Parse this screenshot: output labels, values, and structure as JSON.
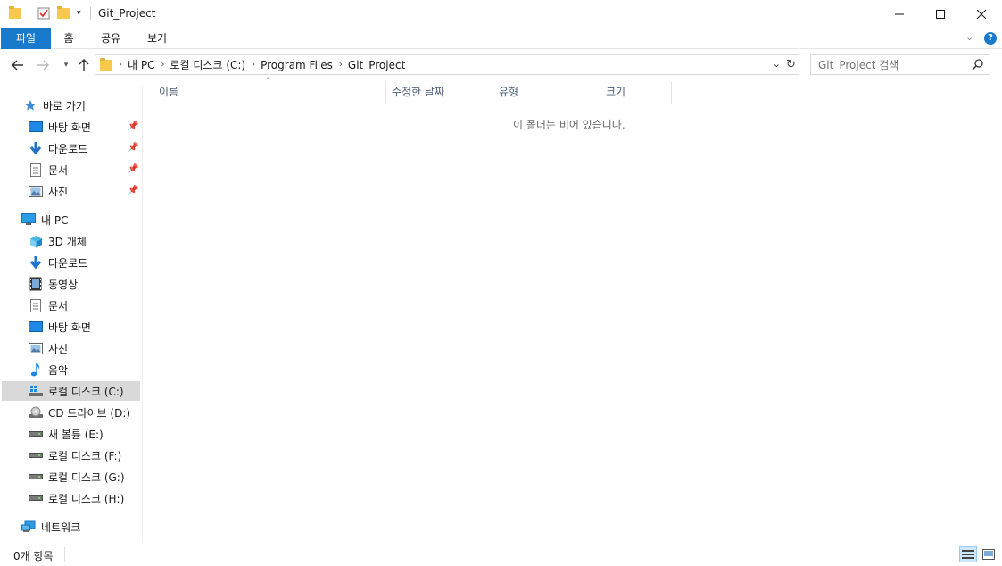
{
  "window": {
    "title": "Git_Project",
    "minimize": "—",
    "maximize": "☐",
    "close": "✕"
  },
  "ribbon": {
    "tabs": [
      "파일",
      "홈",
      "공유",
      "보기"
    ],
    "help": "?"
  },
  "address": {
    "crumbs": [
      "내 PC",
      "로컬 디스크 (C:)",
      "Program Files",
      "Git_Project"
    ]
  },
  "search": {
    "placeholder": "Git_Project 검색"
  },
  "columns": [
    "이름",
    "수정한 날짜",
    "유형",
    "크기"
  ],
  "content": {
    "empty_message": "이 폴더는 비어 있습니다."
  },
  "sidebar": {
    "quick_access": "바로 가기",
    "quick_items": [
      {
        "label": "바탕 화면",
        "icon": "desktop-icon"
      },
      {
        "label": "다운로드",
        "icon": "download-icon"
      },
      {
        "label": "문서",
        "icon": "document-icon"
      },
      {
        "label": "사진",
        "icon": "picture-icon"
      }
    ],
    "this_pc": "내 PC",
    "pc_items": [
      {
        "label": "3D 개체",
        "icon": "3d-objects-icon"
      },
      {
        "label": "다운로드",
        "icon": "download-icon"
      },
      {
        "label": "동영상",
        "icon": "video-icon"
      },
      {
        "label": "문서",
        "icon": "document-icon"
      },
      {
        "label": "바탕 화면",
        "icon": "desktop-icon"
      },
      {
        "label": "사진",
        "icon": "picture-icon"
      },
      {
        "label": "음악",
        "icon": "music-icon"
      },
      {
        "label": "로컬 디스크 (C:)",
        "icon": "system-drive-icon"
      },
      {
        "label": "CD 드라이브 (D:)",
        "icon": "cd-drive-icon"
      },
      {
        "label": "새 볼륨 (E:)",
        "icon": "drive-icon"
      },
      {
        "label": "로컬 디스크 (F:)",
        "icon": "drive-icon"
      },
      {
        "label": "로컬 디스크 (G:)",
        "icon": "drive-icon"
      },
      {
        "label": "로컬 디스크 (H:)",
        "icon": "drive-icon"
      }
    ],
    "network": "네트워크"
  },
  "status": {
    "item_count": "0개 항목"
  },
  "colors": {
    "accent": "#1979ca",
    "selected_bg": "#d9d9d9",
    "header_text": "#4c607a"
  }
}
